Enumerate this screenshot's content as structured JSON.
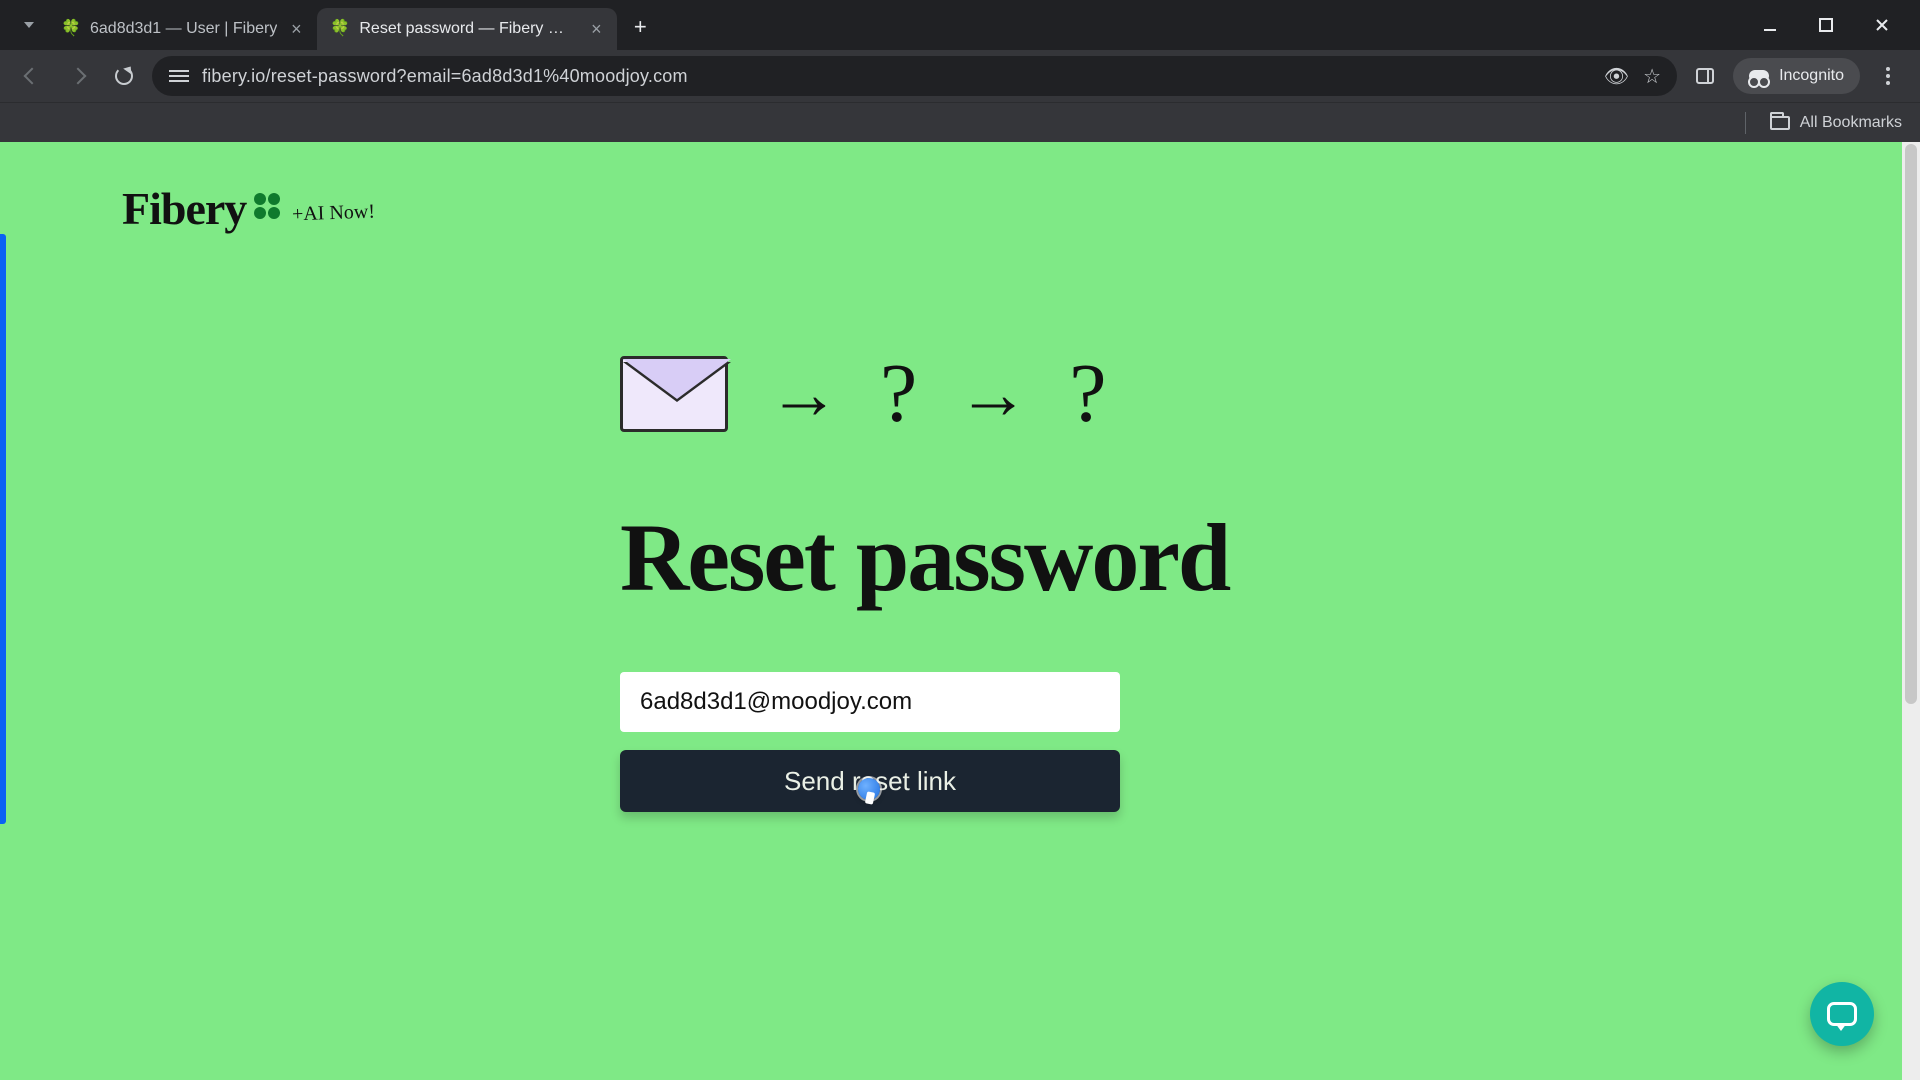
{
  "browser": {
    "tabs": [
      {
        "title": "6ad8d3d1 — User | Fibery",
        "active": false
      },
      {
        "title": "Reset password — Fibery — Fib",
        "active": true
      }
    ],
    "url": "fibery.io/reset-password?email=6ad8d3d1%40moodjoy.com",
    "incognito_label": "Incognito",
    "bookmarks_label": "All Bookmarks"
  },
  "brand": {
    "name": "Fibery",
    "tagline": "+AI Now!"
  },
  "hero": {
    "arrow": "→",
    "question": "?"
  },
  "page": {
    "title": "Reset password",
    "email_value": "6ad8d3d1@moodjoy.com",
    "submit_label": "Send reset link"
  }
}
